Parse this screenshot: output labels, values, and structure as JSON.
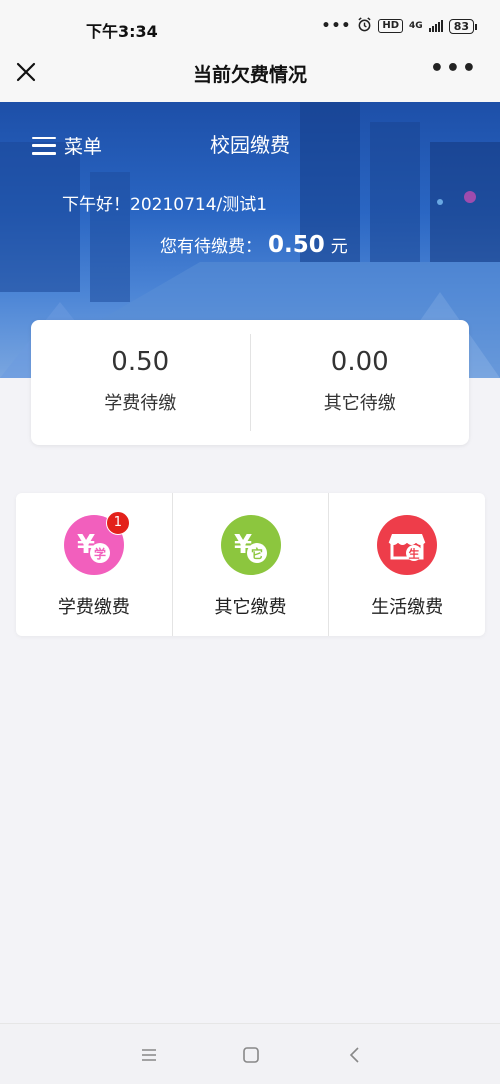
{
  "status_bar": {
    "time": "下午3:34",
    "dots": "•••",
    "hd": "HD",
    "network": "4G",
    "battery": "83"
  },
  "nav": {
    "title": "当前欠费情况"
  },
  "banner": {
    "menu_label": "菜单",
    "title": "校园缴费",
    "greeting": "下午好！20210714/测试1",
    "pending_label": "您有待缴费：",
    "pending_amount": "0.50",
    "pending_unit": "元"
  },
  "summary": [
    {
      "value": "0.50",
      "label": "学费待缴"
    },
    {
      "value": "0.00",
      "label": "其它待缴"
    }
  ],
  "services": [
    {
      "label": "学费缴费",
      "icon": "yuan-study-icon",
      "color": "#f25fbd",
      "tag": "学",
      "badge": "1"
    },
    {
      "label": "其它缴费",
      "icon": "yuan-other-icon",
      "color": "#8cc63e",
      "tag": "它"
    },
    {
      "label": "生活缴费",
      "icon": "shop-life-icon",
      "color": "#ee3d4a",
      "tag": "生"
    }
  ]
}
